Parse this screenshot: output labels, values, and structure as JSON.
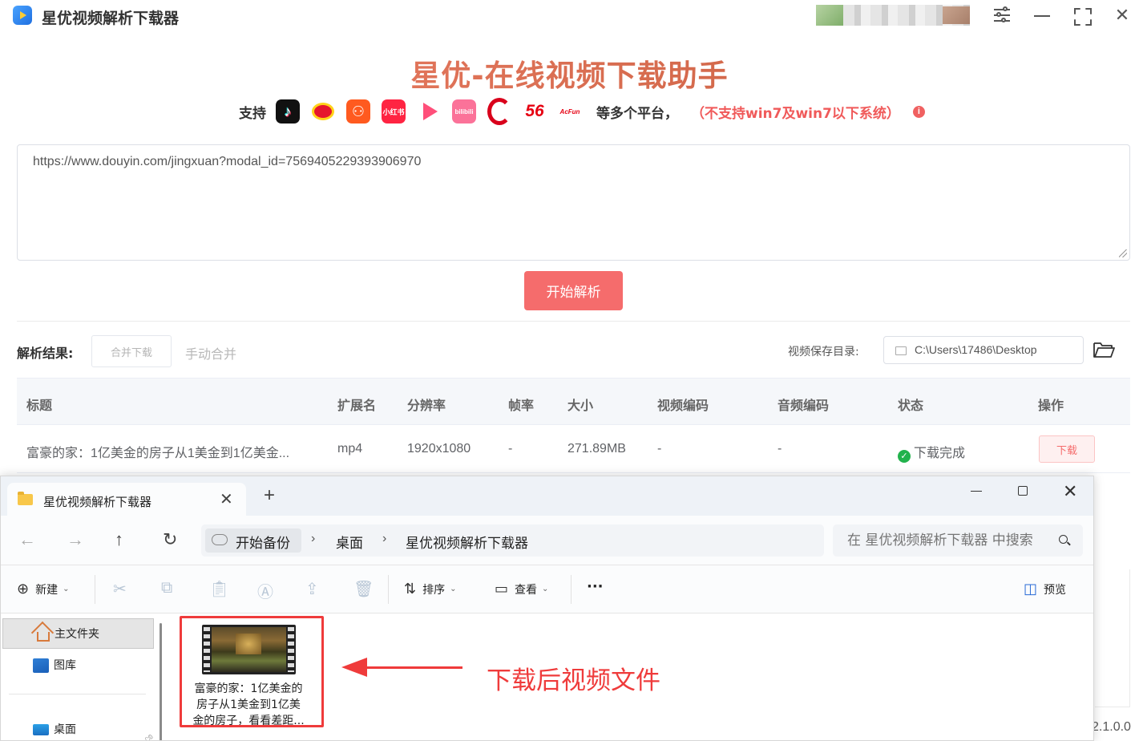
{
  "app": {
    "title": "星优视频解析下载器",
    "hero_title": "星优-在线视频下载助手",
    "support_label": "支持",
    "platforms": [
      "douyin-icon",
      "weibo-icon",
      "kuaishou-icon",
      "xiaohongshu-icon",
      "play-icon",
      "bilibili-icon",
      "cntv-icon",
      "56-icon",
      "acfun-icon"
    ],
    "platform_text": {
      "xhs": "小红书",
      "bili": "bilibili",
      "v56": "56",
      "acfun": "AcFun"
    },
    "more_platforms": "等多个平台，",
    "warning": "（不支持win7及win7以下系统）",
    "info_glyph": "i",
    "url_value": "https://www.douyin.com/jingxuan?modal_id=7569405229393906970",
    "parse_button": "开始解析",
    "results_label": "解析结果:",
    "merge_download": "合并下载",
    "manual_merge": "手动合并",
    "save_dir_label": "视频保存目录:",
    "save_dir_value": "C:\\Users\\17486\\Desktop",
    "version": "2.1.0.0",
    "accent_color": "#f56c6c"
  },
  "table": {
    "headers": [
      "标题",
      "扩展名",
      "分辨率",
      "帧率",
      "大小",
      "视频编码",
      "音频编码",
      "状态",
      "操作"
    ],
    "rows": [
      {
        "title": "富豪的家：1亿美金的房子从1美金到1亿美金...",
        "ext": "mp4",
        "resolution": "1920x1080",
        "fps": "-",
        "size": "271.89MB",
        "vcodec": "-",
        "acodec": "-",
        "status": "下载完成",
        "action": "下载"
      }
    ]
  },
  "explorer": {
    "tab_title": "星优视频解析下载器",
    "new_tab": "+",
    "breadcrumb": [
      "开始备份",
      "桌面",
      "星优视频解析下载器"
    ],
    "search_placeholder": "在 星优视频解析下载器 中搜索",
    "toolbar": {
      "new": "新建",
      "sort": "排序",
      "view": "查看",
      "more": "···",
      "preview": "预览"
    },
    "sidebar": [
      {
        "label": "主文件夹",
        "icon": "home-icon"
      },
      {
        "label": "图库",
        "icon": "gallery-icon"
      },
      {
        "label": "桌面",
        "icon": "desktop-icon"
      }
    ],
    "file": {
      "name": "富豪的家：1亿美金的房子从1美金到1亿美金的房子，看看差距..."
    }
  },
  "annotation": {
    "text": "下载后视频文件",
    "color": "#ef3b3b"
  }
}
